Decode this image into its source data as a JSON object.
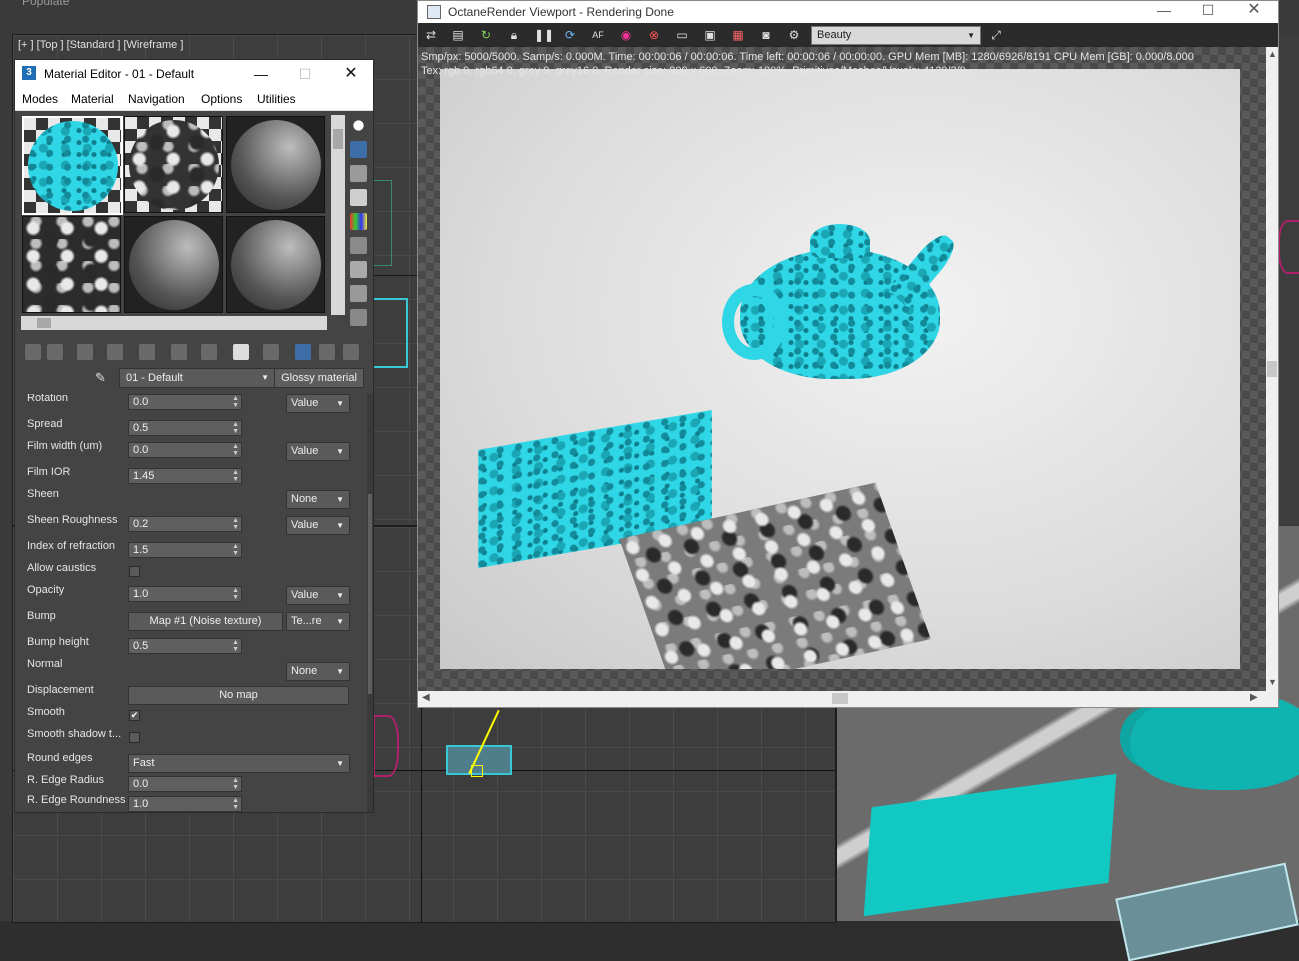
{
  "background": {
    "menu_fragment": "Populate",
    "viewport_label": "[+ ] [Top ] [Standard ] [Wireframe ]"
  },
  "material_editor": {
    "title": "Material Editor - 01 - Default",
    "window_icon": "3",
    "menu": [
      "Modes",
      "Material",
      "Navigation",
      "Options",
      "Utilities"
    ],
    "material_name": "01 - Default",
    "material_type": "Glossy material",
    "params": {
      "rotation": {
        "label": "Rotation",
        "value": "0.0",
        "mode": "Value"
      },
      "spread": {
        "label": "Spread",
        "value": "0.5"
      },
      "film_width": {
        "label": "Film width (um)",
        "value": "0.0",
        "mode": "Value"
      },
      "film_ior": {
        "label": "Film IOR",
        "value": "1.45"
      },
      "sheen": {
        "label": "Sheen",
        "mode": "None"
      },
      "sheen_roughness": {
        "label": "Sheen Roughness",
        "value": "0.2",
        "mode": "Value"
      },
      "ior": {
        "label": "Index of refraction",
        "value": "1.5"
      },
      "allow_caustics": {
        "label": "Allow caustics",
        "checked": ""
      },
      "opacity": {
        "label": "Opacity",
        "value": "1.0",
        "mode": "Value"
      },
      "bump": {
        "label": "Bump",
        "map": "Map #1 (Noise texture)",
        "mode": "Te...re"
      },
      "bump_height": {
        "label": "Bump height",
        "value": "0.5"
      },
      "normal": {
        "label": "Normal",
        "mode": "None"
      },
      "displacement": {
        "label": "Displacement",
        "map": "No map"
      },
      "smooth": {
        "label": "Smooth",
        "checked": "✔"
      },
      "smooth_shadow": {
        "label": "Smooth shadow t...",
        "checked": ""
      },
      "round_edges": {
        "label": "Round edges",
        "value": "Fast"
      },
      "edge_radius": {
        "label": "R. Edge Radius",
        "value": "0.0"
      },
      "edge_roundness": {
        "label": "R. Edge Roundness",
        "value": "1.0"
      }
    }
  },
  "octane": {
    "title": "OctaneRender Viewport - Rendering Done",
    "pass": "Beauty",
    "stats_line1": "Smp/px: 5000/5000.   Samp/s: 0.000M.   Time: 00:00:06 / 00:00:06.   Time left: 00:00:06 / 00:00:00.   GPU Mem [MB]: 1280/6926/8191   CPU Mem [GB]: 0.000/8.000",
    "stats_line2": "Tex: rgb 0, rgb64 0, grey 0, grey16 0.   Render size: 800 x 600.   Zoom: 100%.   Primitives/Meshes/Voxels: 4120/2/0"
  },
  "colors": {
    "teal": "#0fb3b0",
    "cyan_material": "#2fd6e6"
  }
}
